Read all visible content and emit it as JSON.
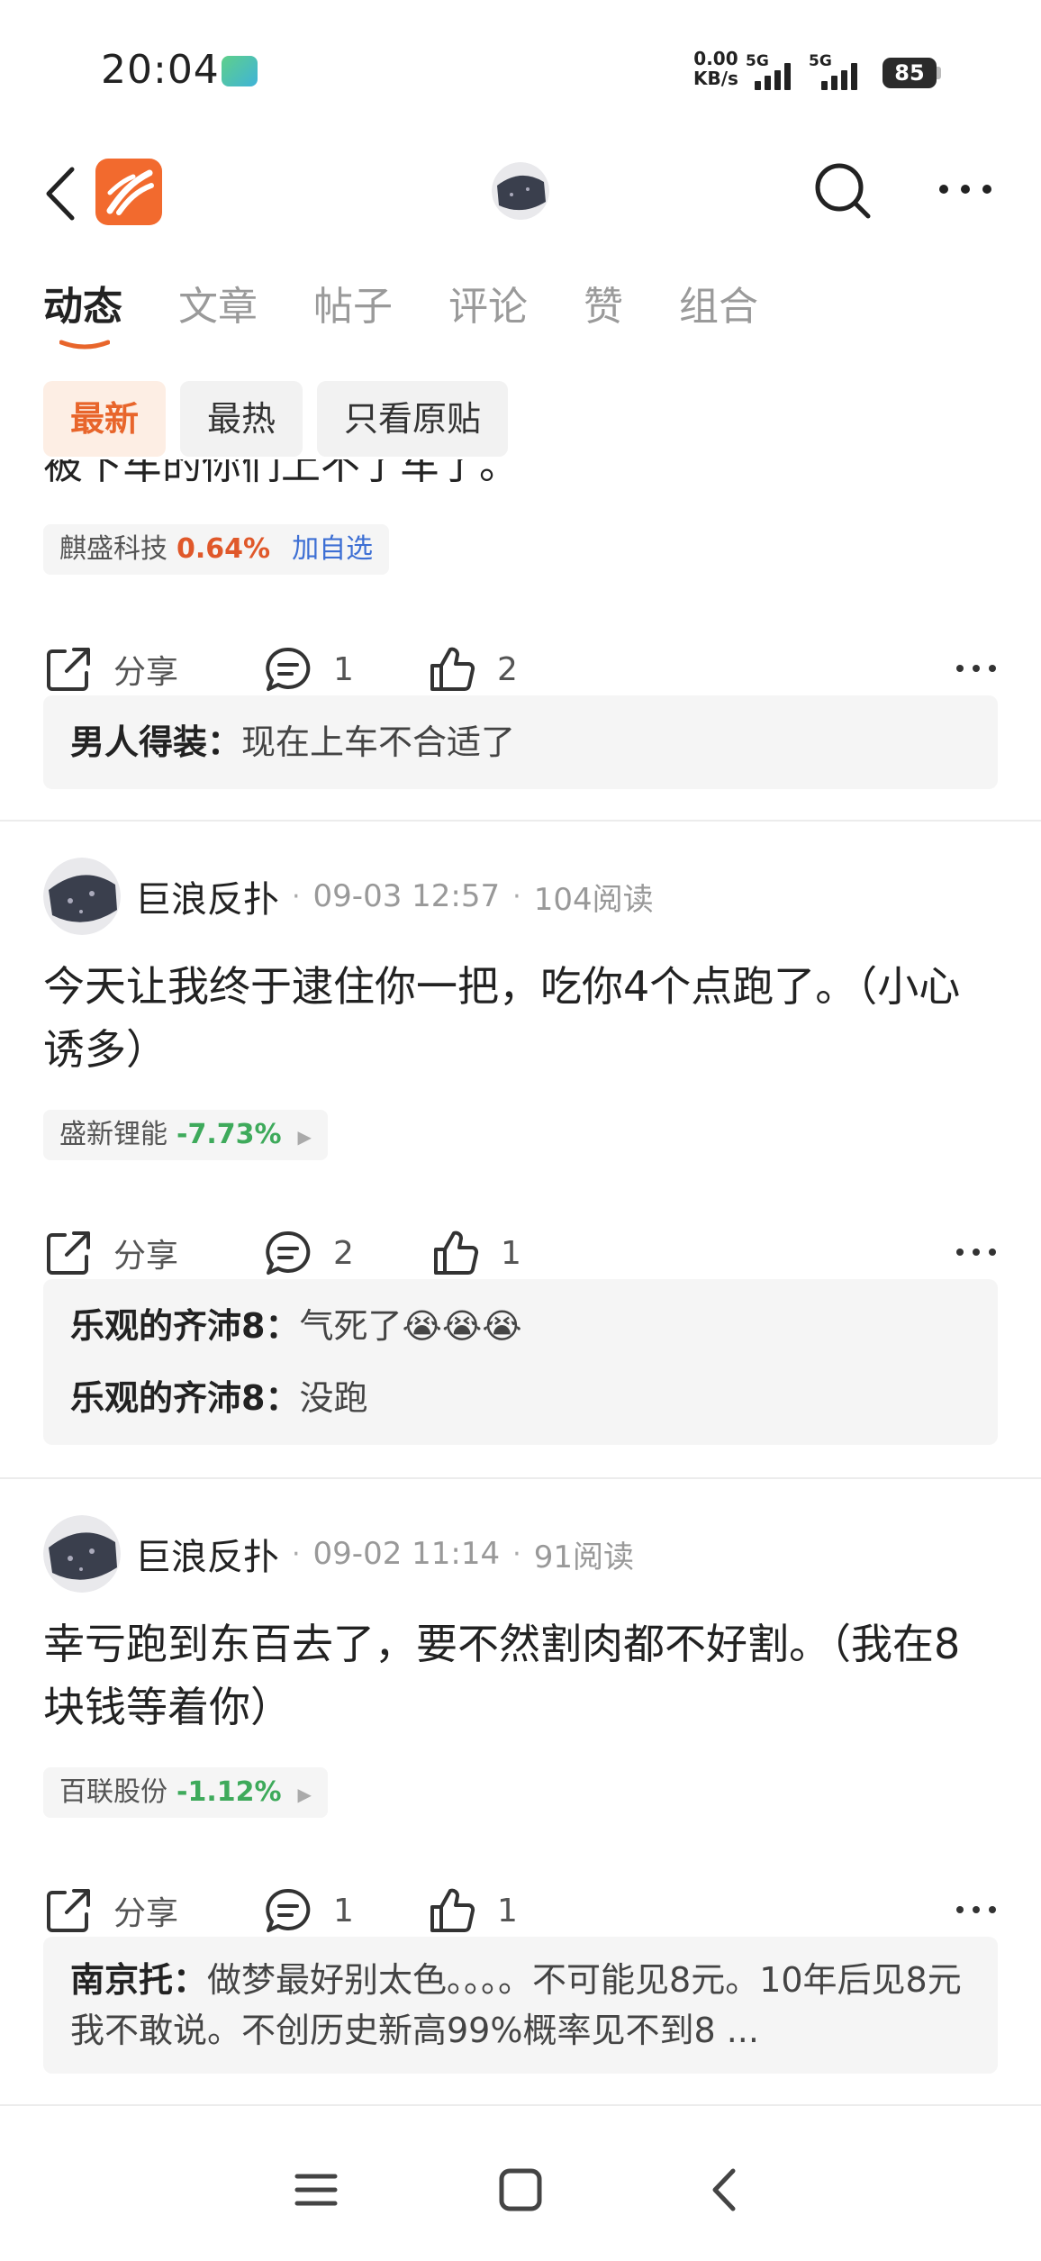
{
  "status_bar": {
    "time": "20:04",
    "net_speed_value": "0.00",
    "net_speed_unit": "KB/s",
    "sim1_label": "5G",
    "sim2_label": "5G",
    "battery": "85"
  },
  "header": {
    "back_icon": "chevron-left-icon",
    "app_logo": "app-logo-icon",
    "search_icon": "search-icon",
    "more_icon": "more-horizontal-icon"
  },
  "tabs": [
    {
      "label": "动态",
      "active": true
    },
    {
      "label": "文章",
      "active": false
    },
    {
      "label": "帖子",
      "active": false
    },
    {
      "label": "评论",
      "active": false
    },
    {
      "label": "赞",
      "active": false
    },
    {
      "label": "组合",
      "active": false
    }
  ],
  "filters": [
    {
      "label": "最新",
      "active": true
    },
    {
      "label": "最热",
      "active": false
    },
    {
      "label": "只看原贴",
      "active": false
    }
  ],
  "feed": {
    "post0": {
      "truncated_text": "被下车的你们上不了车了。",
      "stock": {
        "name": "麒盛科技",
        "change": "0.64%",
        "add": "加自选"
      },
      "share_label": "分享",
      "comment_count": "1",
      "like_count": "2",
      "comments": [
        {
          "user": "男人得装：",
          "text": "现在上车不合适了"
        }
      ]
    },
    "post1": {
      "author": "巨浪反扑",
      "date": "09-03 12:57",
      "reads": "104阅读",
      "text": "今天让我终于逮住你一把，吃你4个点跑了。（小心诱多）",
      "stock": {
        "name": "盛新锂能",
        "change": "-7.73%"
      },
      "share_label": "分享",
      "comment_count": "2",
      "like_count": "1",
      "comments": [
        {
          "user": "乐观的齐沛8：",
          "text": "气死了😭😭😭"
        },
        {
          "user": "乐观的齐沛8：",
          "text": "没跑"
        }
      ]
    },
    "post2": {
      "author": "巨浪反扑",
      "date": "09-02 11:14",
      "reads": "91阅读",
      "text": "幸亏跑到东百去了，要不然割肉都不好割。（我在8块钱等着你）",
      "stock": {
        "name": "百联股份",
        "change": "-1.12%"
      },
      "share_label": "分享",
      "comment_count": "1",
      "like_count": "1",
      "comments": [
        {
          "user": "南京托：",
          "text": "做梦最好别太色。。。。不可能见8元。10年后见8元我不敢说。不创历史新高99%概率见不到8 ..."
        }
      ]
    }
  },
  "colors": {
    "accent": "#e8652b",
    "rise": "#e0582a",
    "fall": "#3eaa5b",
    "link": "#3d6fd4"
  }
}
